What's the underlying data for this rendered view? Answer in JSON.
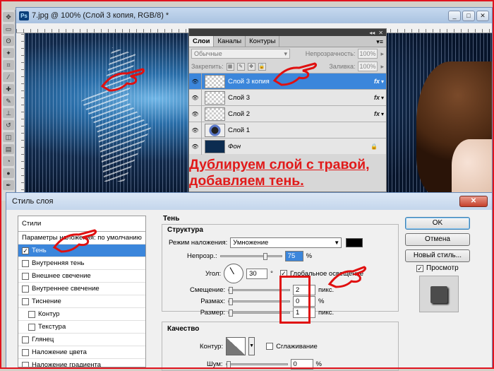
{
  "document": {
    "title": "7.jpg @ 100% (Слой 3 копия, RGB/8) *",
    "window_buttons": [
      "_",
      "□",
      "✕"
    ]
  },
  "layers_panel": {
    "tabs": [
      "Слои",
      "Каналы",
      "Контуры"
    ],
    "active_tab": "Слои",
    "blend_mode": "Обычные",
    "opacity_label": "Непрозрачность:",
    "opacity_value": "100%",
    "lock_label": "Закрепить:",
    "fill_label": "Заливка:",
    "fill_value": "100%",
    "layers": [
      {
        "name": "Слой 3 копия",
        "fx": "fx",
        "selected": true,
        "thumb": "checker"
      },
      {
        "name": "Слой 3",
        "fx": "fx",
        "selected": false,
        "thumb": "checker"
      },
      {
        "name": "Слой 2",
        "fx": "fx",
        "selected": false,
        "thumb": "checker"
      },
      {
        "name": "Слой 1",
        "fx": "",
        "selected": false,
        "thumb": "mid"
      },
      {
        "name": "Фон",
        "fx": "",
        "selected": false,
        "thumb": "dark",
        "locked": true
      }
    ]
  },
  "caption": {
    "line1": "Дублируем слой с травой,",
    "line2": "добавляем тень."
  },
  "dialog": {
    "title": "Стиль слоя",
    "close": "✕",
    "styles_header": "Стили",
    "styles": [
      {
        "label": "Параметры наложения: по умолчанию",
        "checkbox": false,
        "indent": false,
        "selected": false
      },
      {
        "label": "Тень",
        "checkbox": true,
        "checked": true,
        "indent": false,
        "selected": true
      },
      {
        "label": "Внутренняя тень",
        "checkbox": true,
        "checked": false,
        "indent": false,
        "selected": false
      },
      {
        "label": "Внешнее свечение",
        "checkbox": true,
        "checked": false,
        "indent": false,
        "selected": false
      },
      {
        "label": "Внутреннее свечение",
        "checkbox": true,
        "checked": false,
        "indent": false,
        "selected": false
      },
      {
        "label": "Тиснение",
        "checkbox": true,
        "checked": false,
        "indent": false,
        "selected": false
      },
      {
        "label": "Контур",
        "checkbox": true,
        "checked": false,
        "indent": true,
        "selected": false
      },
      {
        "label": "Текстура",
        "checkbox": true,
        "checked": false,
        "indent": true,
        "selected": false
      },
      {
        "label": "Глянец",
        "checkbox": true,
        "checked": false,
        "indent": false,
        "selected": false
      },
      {
        "label": "Наложение цвета",
        "checkbox": true,
        "checked": false,
        "indent": false,
        "selected": false
      },
      {
        "label": "Наложение градиента",
        "checkbox": true,
        "checked": false,
        "indent": false,
        "selected": false
      }
    ],
    "section_title": "Тень",
    "structure_title": "Структура",
    "blend_label": "Режим наложения:",
    "blend_value": "Умножение",
    "shadow_color": "#000000",
    "opacity_label": "Непрозр.:",
    "opacity_value": "75",
    "opacity_unit": "%",
    "angle_label": "Угол:",
    "angle_value": "30",
    "angle_unit": "°",
    "global_light_label": "Глобальное освещение",
    "global_light_checked": true,
    "distance_label": "Смещение:",
    "distance_value": "2",
    "distance_unit": "пикс.",
    "spread_label": "Размах:",
    "spread_value": "0",
    "spread_unit": "%",
    "size_label": "Размер:",
    "size_value": "1",
    "size_unit": "пикс.",
    "quality_title": "Качество",
    "contour_label": "Контур:",
    "antialias_label": "Сглаживание",
    "noise_label": "Шум:",
    "noise_value": "0",
    "noise_unit": "%",
    "buttons": {
      "ok": "OK",
      "cancel": "Отмена",
      "new_style": "Новый стиль...",
      "preview": "Просмотр"
    },
    "preview_checked": true
  }
}
